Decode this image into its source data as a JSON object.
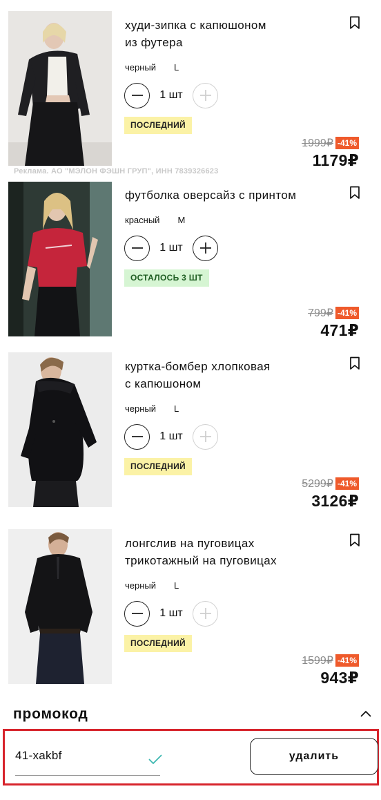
{
  "cart": {
    "items": [
      {
        "title_line1": "худи-зипка с капюшоном",
        "title_line2": "из футера",
        "color": "черный",
        "size": "L",
        "quantity": "1 шт",
        "badge": "ПОСЛЕДНИЙ",
        "old_price": "1999₽",
        "discount": "-41%",
        "price": "1179₽",
        "ad_notice": "Реклама. АО \"МЭЛОН ФЭШН ГРУП\", ИНН 7839326623"
      },
      {
        "title_line1": "футболка оверсайз с принтом",
        "color": "красный",
        "size": "M",
        "quantity": "1 шт",
        "badge": "ОСТАЛОСЬ 3 ШТ",
        "old_price": "799₽",
        "discount": "-41%",
        "price": "471₽"
      },
      {
        "title_line1": "куртка-бомбер хлопковая",
        "title_line2": "с капюшоном",
        "color": "черный",
        "size": "L",
        "quantity": "1 шт",
        "badge": "ПОСЛЕДНИЙ",
        "old_price": "5299₽",
        "discount": "-41%",
        "price": "3126₽"
      },
      {
        "title_line1": "лонгслив на пуговицах",
        "title_line2": "трикотажный на пуговицах",
        "color": "черный",
        "size": "L",
        "quantity": "1 шт",
        "badge": "ПОСЛЕДНИЙ",
        "old_price": "1599₽",
        "discount": "-41%",
        "price": "943₽"
      }
    ]
  },
  "promo": {
    "title": "промокод",
    "code": "41-xakbf",
    "remove_label": "удалить"
  },
  "colors": {
    "discount_badge": "#ef5a2b",
    "badge_last": "#fbf2a6",
    "badge_left": "#d6f5d3",
    "promo_highlight": "#d7232b",
    "check": "#3bb7b0"
  },
  "icons": [
    "bookmark-icon",
    "minus-icon",
    "plus-icon",
    "chevron-up-icon",
    "check-icon"
  ]
}
